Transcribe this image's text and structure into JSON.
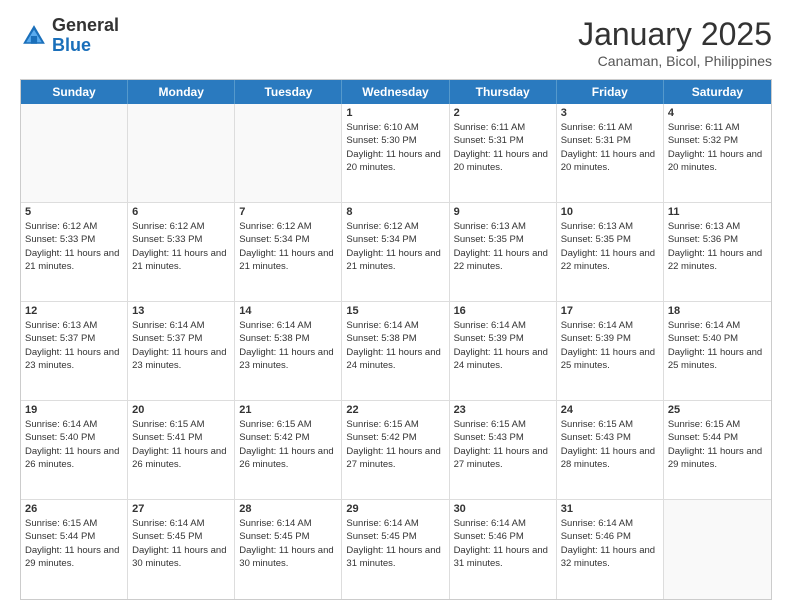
{
  "logo": {
    "general": "General",
    "blue": "Blue"
  },
  "header": {
    "month": "January 2025",
    "location": "Canaman, Bicol, Philippines"
  },
  "weekdays": [
    "Sunday",
    "Monday",
    "Tuesday",
    "Wednesday",
    "Thursday",
    "Friday",
    "Saturday"
  ],
  "weeks": [
    [
      {
        "day": "",
        "sunrise": "",
        "sunset": "",
        "daylight": ""
      },
      {
        "day": "",
        "sunrise": "",
        "sunset": "",
        "daylight": ""
      },
      {
        "day": "",
        "sunrise": "",
        "sunset": "",
        "daylight": ""
      },
      {
        "day": "1",
        "sunrise": "Sunrise: 6:10 AM",
        "sunset": "Sunset: 5:30 PM",
        "daylight": "Daylight: 11 hours and 20 minutes."
      },
      {
        "day": "2",
        "sunrise": "Sunrise: 6:11 AM",
        "sunset": "Sunset: 5:31 PM",
        "daylight": "Daylight: 11 hours and 20 minutes."
      },
      {
        "day": "3",
        "sunrise": "Sunrise: 6:11 AM",
        "sunset": "Sunset: 5:31 PM",
        "daylight": "Daylight: 11 hours and 20 minutes."
      },
      {
        "day": "4",
        "sunrise": "Sunrise: 6:11 AM",
        "sunset": "Sunset: 5:32 PM",
        "daylight": "Daylight: 11 hours and 20 minutes."
      }
    ],
    [
      {
        "day": "5",
        "sunrise": "Sunrise: 6:12 AM",
        "sunset": "Sunset: 5:33 PM",
        "daylight": "Daylight: 11 hours and 21 minutes."
      },
      {
        "day": "6",
        "sunrise": "Sunrise: 6:12 AM",
        "sunset": "Sunset: 5:33 PM",
        "daylight": "Daylight: 11 hours and 21 minutes."
      },
      {
        "day": "7",
        "sunrise": "Sunrise: 6:12 AM",
        "sunset": "Sunset: 5:34 PM",
        "daylight": "Daylight: 11 hours and 21 minutes."
      },
      {
        "day": "8",
        "sunrise": "Sunrise: 6:12 AM",
        "sunset": "Sunset: 5:34 PM",
        "daylight": "Daylight: 11 hours and 21 minutes."
      },
      {
        "day": "9",
        "sunrise": "Sunrise: 6:13 AM",
        "sunset": "Sunset: 5:35 PM",
        "daylight": "Daylight: 11 hours and 22 minutes."
      },
      {
        "day": "10",
        "sunrise": "Sunrise: 6:13 AM",
        "sunset": "Sunset: 5:35 PM",
        "daylight": "Daylight: 11 hours and 22 minutes."
      },
      {
        "day": "11",
        "sunrise": "Sunrise: 6:13 AM",
        "sunset": "Sunset: 5:36 PM",
        "daylight": "Daylight: 11 hours and 22 minutes."
      }
    ],
    [
      {
        "day": "12",
        "sunrise": "Sunrise: 6:13 AM",
        "sunset": "Sunset: 5:37 PM",
        "daylight": "Daylight: 11 hours and 23 minutes."
      },
      {
        "day": "13",
        "sunrise": "Sunrise: 6:14 AM",
        "sunset": "Sunset: 5:37 PM",
        "daylight": "Daylight: 11 hours and 23 minutes."
      },
      {
        "day": "14",
        "sunrise": "Sunrise: 6:14 AM",
        "sunset": "Sunset: 5:38 PM",
        "daylight": "Daylight: 11 hours and 23 minutes."
      },
      {
        "day": "15",
        "sunrise": "Sunrise: 6:14 AM",
        "sunset": "Sunset: 5:38 PM",
        "daylight": "Daylight: 11 hours and 24 minutes."
      },
      {
        "day": "16",
        "sunrise": "Sunrise: 6:14 AM",
        "sunset": "Sunset: 5:39 PM",
        "daylight": "Daylight: 11 hours and 24 minutes."
      },
      {
        "day": "17",
        "sunrise": "Sunrise: 6:14 AM",
        "sunset": "Sunset: 5:39 PM",
        "daylight": "Daylight: 11 hours and 25 minutes."
      },
      {
        "day": "18",
        "sunrise": "Sunrise: 6:14 AM",
        "sunset": "Sunset: 5:40 PM",
        "daylight": "Daylight: 11 hours and 25 minutes."
      }
    ],
    [
      {
        "day": "19",
        "sunrise": "Sunrise: 6:14 AM",
        "sunset": "Sunset: 5:40 PM",
        "daylight": "Daylight: 11 hours and 26 minutes."
      },
      {
        "day": "20",
        "sunrise": "Sunrise: 6:15 AM",
        "sunset": "Sunset: 5:41 PM",
        "daylight": "Daylight: 11 hours and 26 minutes."
      },
      {
        "day": "21",
        "sunrise": "Sunrise: 6:15 AM",
        "sunset": "Sunset: 5:42 PM",
        "daylight": "Daylight: 11 hours and 26 minutes."
      },
      {
        "day": "22",
        "sunrise": "Sunrise: 6:15 AM",
        "sunset": "Sunset: 5:42 PM",
        "daylight": "Daylight: 11 hours and 27 minutes."
      },
      {
        "day": "23",
        "sunrise": "Sunrise: 6:15 AM",
        "sunset": "Sunset: 5:43 PM",
        "daylight": "Daylight: 11 hours and 27 minutes."
      },
      {
        "day": "24",
        "sunrise": "Sunrise: 6:15 AM",
        "sunset": "Sunset: 5:43 PM",
        "daylight": "Daylight: 11 hours and 28 minutes."
      },
      {
        "day": "25",
        "sunrise": "Sunrise: 6:15 AM",
        "sunset": "Sunset: 5:44 PM",
        "daylight": "Daylight: 11 hours and 29 minutes."
      }
    ],
    [
      {
        "day": "26",
        "sunrise": "Sunrise: 6:15 AM",
        "sunset": "Sunset: 5:44 PM",
        "daylight": "Daylight: 11 hours and 29 minutes."
      },
      {
        "day": "27",
        "sunrise": "Sunrise: 6:14 AM",
        "sunset": "Sunset: 5:45 PM",
        "daylight": "Daylight: 11 hours and 30 minutes."
      },
      {
        "day": "28",
        "sunrise": "Sunrise: 6:14 AM",
        "sunset": "Sunset: 5:45 PM",
        "daylight": "Daylight: 11 hours and 30 minutes."
      },
      {
        "day": "29",
        "sunrise": "Sunrise: 6:14 AM",
        "sunset": "Sunset: 5:45 PM",
        "daylight": "Daylight: 11 hours and 31 minutes."
      },
      {
        "day": "30",
        "sunrise": "Sunrise: 6:14 AM",
        "sunset": "Sunset: 5:46 PM",
        "daylight": "Daylight: 11 hours and 31 minutes."
      },
      {
        "day": "31",
        "sunrise": "Sunrise: 6:14 AM",
        "sunset": "Sunset: 5:46 PM",
        "daylight": "Daylight: 11 hours and 32 minutes."
      },
      {
        "day": "",
        "sunrise": "",
        "sunset": "",
        "daylight": ""
      }
    ]
  ]
}
